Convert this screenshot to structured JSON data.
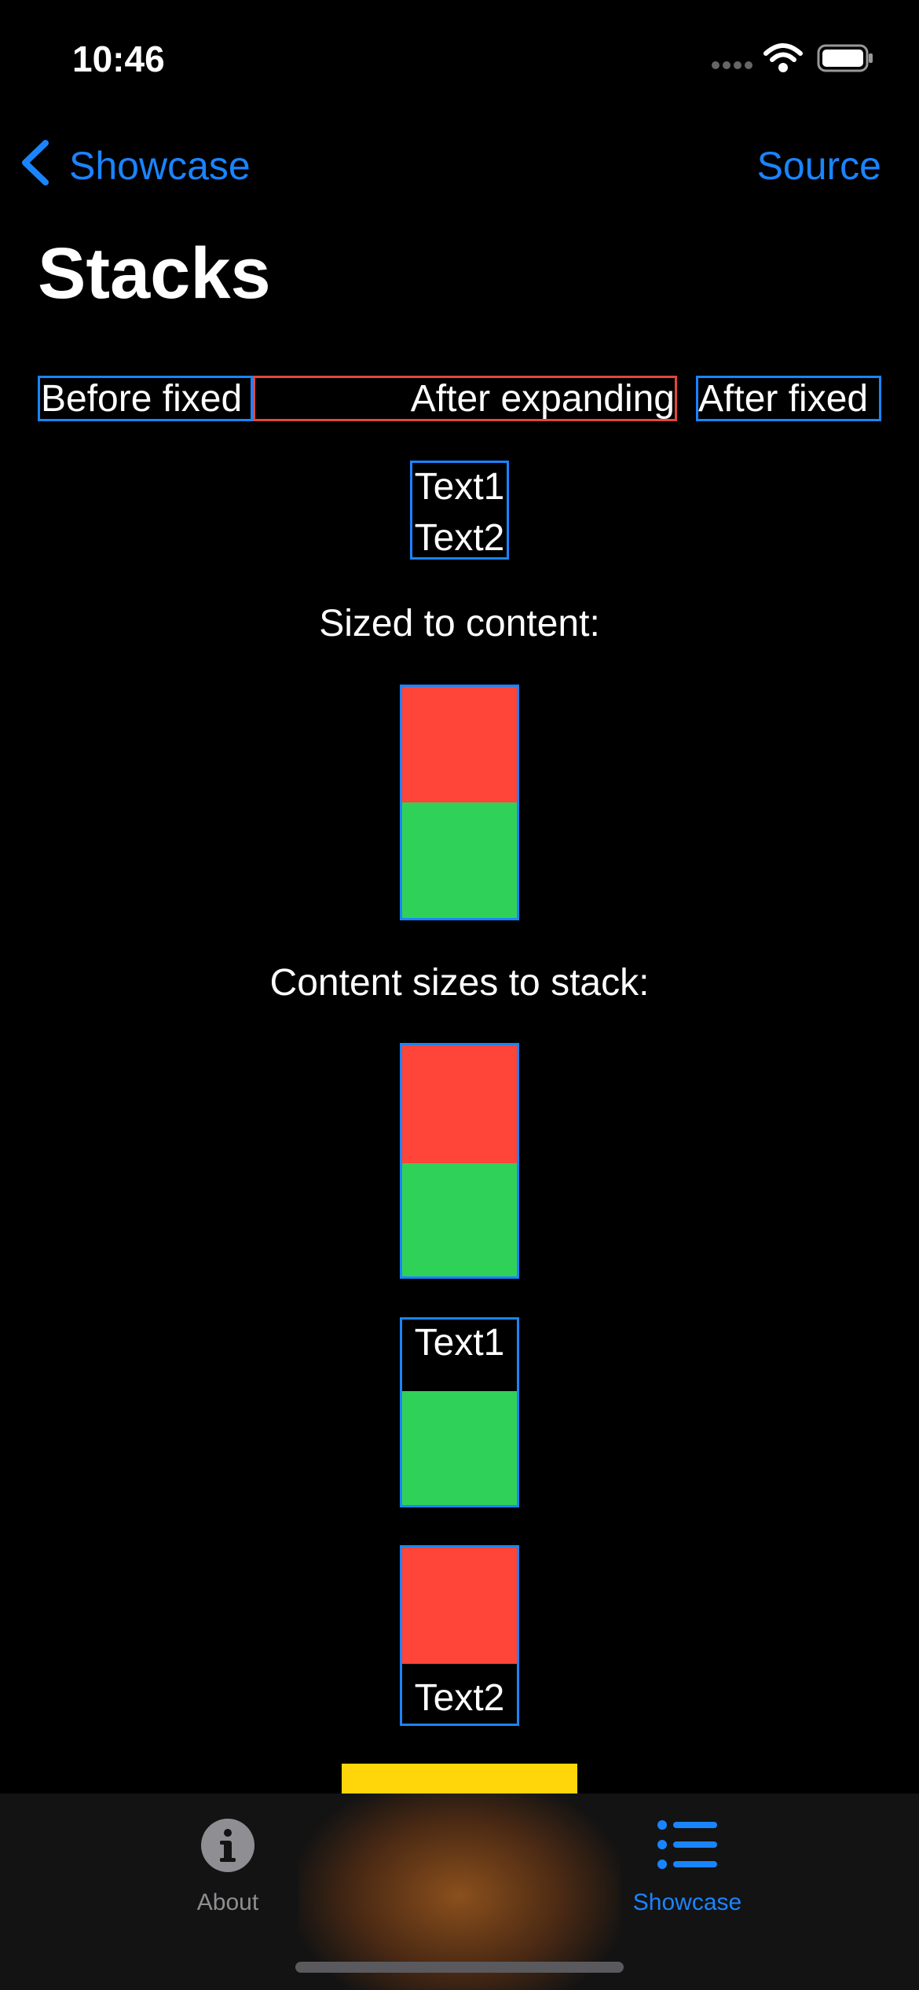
{
  "status_bar": {
    "time": "10:46"
  },
  "nav": {
    "back_label": "Showcase",
    "source_label": "Source",
    "title": "Stacks"
  },
  "row": {
    "before_fixed": "Before fixed",
    "after_expanding": "After expanding",
    "after_fixed": "After fixed"
  },
  "vstack_text": {
    "text1": "Text1",
    "text2": "Text2"
  },
  "sections": {
    "sized_to_content": "Sized to content:",
    "content_sizes_to_stack": "Content sizes to stack:"
  },
  "mixed_1": {
    "text": "Text1"
  },
  "mixed_2": {
    "text": "Text2"
  },
  "tab_bar": {
    "about_label": "About",
    "showcase_label": "Showcase",
    "selected": "Showcase"
  },
  "colors": {
    "accent": "#1a84ff",
    "red": "#ff453a",
    "green": "#30d158",
    "yellow": "#ffd60a",
    "border_red": "#e0473c"
  }
}
